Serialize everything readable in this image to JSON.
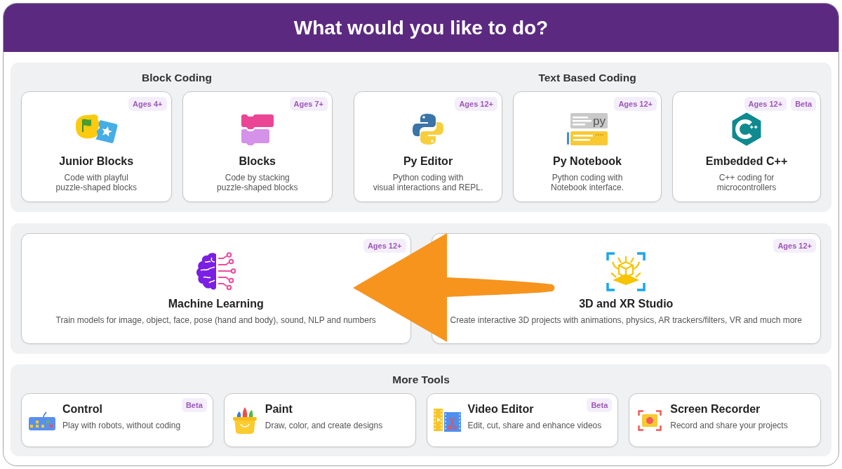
{
  "header": {
    "title": "What would you like to do?"
  },
  "sections": [
    {
      "kind": "grouped",
      "groups": [
        {
          "heading": "Block Coding",
          "cards": [
            {
              "title": "Junior Blocks",
              "description": [
                "Code with playful",
                "puzzle-shaped blocks"
              ],
              "badges": [
                "Ages 4+"
              ]
            },
            {
              "title": "Blocks",
              "description": [
                "Code by stacking",
                "puzzle-shaped blocks"
              ],
              "badges": [
                "Ages 7+"
              ]
            }
          ]
        },
        {
          "heading": "Text Based Coding",
          "cards": [
            {
              "title": "Py Editor",
              "description": [
                "Python coding with",
                "visual interactions and REPL."
              ],
              "badges": [
                "Ages 12+"
              ]
            },
            {
              "title": "Py Notebook",
              "icon_label": "py",
              "description": [
                "Python coding with",
                "Notebook interface."
              ],
              "badges": [
                "Ages 12+"
              ]
            },
            {
              "title": "Embedded C++",
              "description": [
                "C++ coding for",
                "microcontrollers"
              ],
              "badges": [
                "Ages 12+",
                "Beta"
              ]
            }
          ]
        }
      ]
    },
    {
      "kind": "wide",
      "cards": [
        {
          "title": "Machine Learning",
          "description": [
            "Train models for image, object, face, pose (hand and body), sound, NLP and numbers"
          ],
          "badges": [
            "Ages 12+"
          ]
        },
        {
          "title": "3D and XR Studio",
          "description": [
            "Create interactive 3D projects with animations, physics, AR trackers/filters, VR and much more"
          ],
          "badges": [
            "Ages 12+"
          ]
        }
      ]
    },
    {
      "kind": "compact",
      "heading": "More Tools",
      "cards": [
        {
          "title": "Control",
          "description": [
            "Play with robots, without coding"
          ],
          "badges": [
            "Beta"
          ]
        },
        {
          "title": "Paint",
          "description": [
            "Draw, color, and create designs"
          ]
        },
        {
          "title": "Video Editor",
          "description": [
            "Edit, cut, share and enhance videos"
          ],
          "badges": [
            "Beta"
          ]
        },
        {
          "title": "Screen Recorder",
          "description": [
            "Record and share your projects"
          ]
        }
      ]
    }
  ]
}
